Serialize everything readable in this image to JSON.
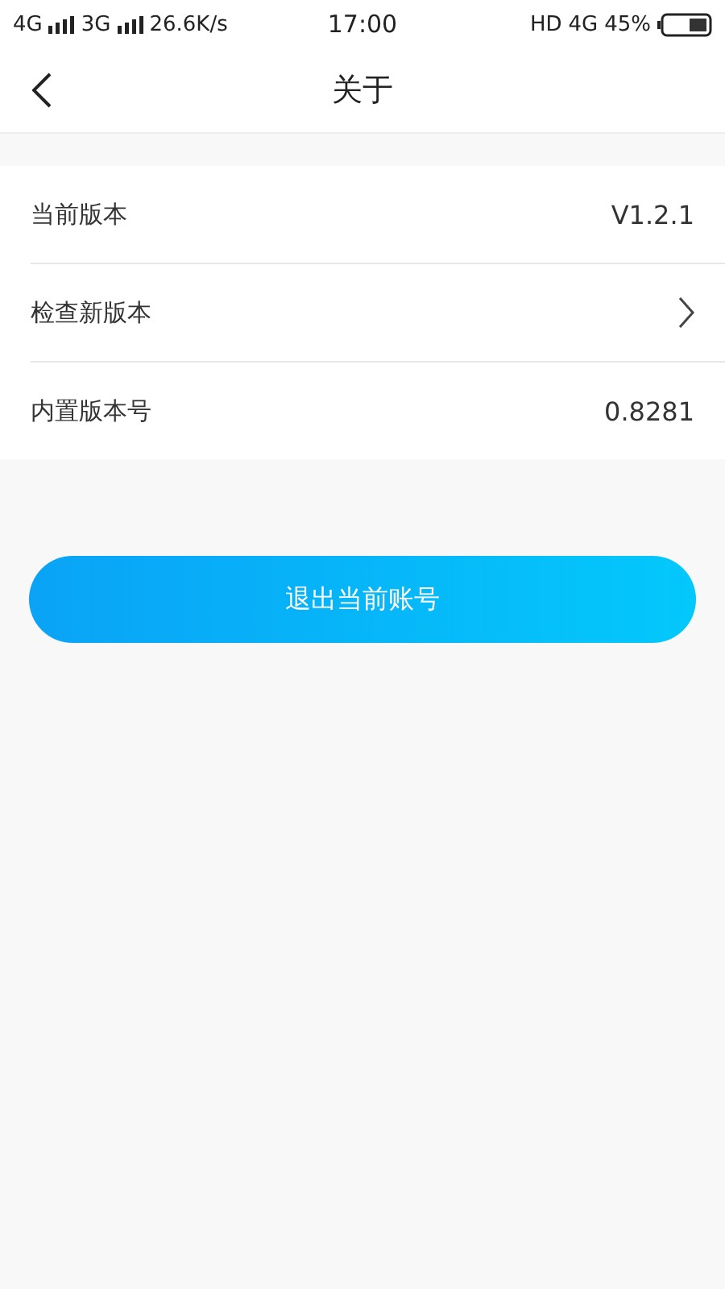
{
  "status_bar": {
    "left": [
      {
        "kind": "text",
        "text": "4G"
      },
      {
        "kind": "signal"
      },
      {
        "kind": "text",
        "text": "3G"
      },
      {
        "kind": "signal"
      },
      {
        "kind": "text",
        "text": "26.6K/s"
      }
    ],
    "time": "17:00",
    "right": [
      {
        "kind": "text",
        "text": "HD"
      },
      {
        "kind": "text",
        "text": "4G"
      },
      {
        "kind": "text",
        "text": "45%"
      },
      {
        "kind": "battery"
      }
    ]
  },
  "header": {
    "title": "关于"
  },
  "rows": [
    {
      "kind": "value",
      "label": "当前版本",
      "value": "V1.2.1"
    },
    {
      "kind": "link",
      "label": "检查新版本"
    },
    {
      "kind": "value",
      "label": "内置版本号",
      "value": "0.8281"
    }
  ],
  "logout_button": "退出当前账号"
}
